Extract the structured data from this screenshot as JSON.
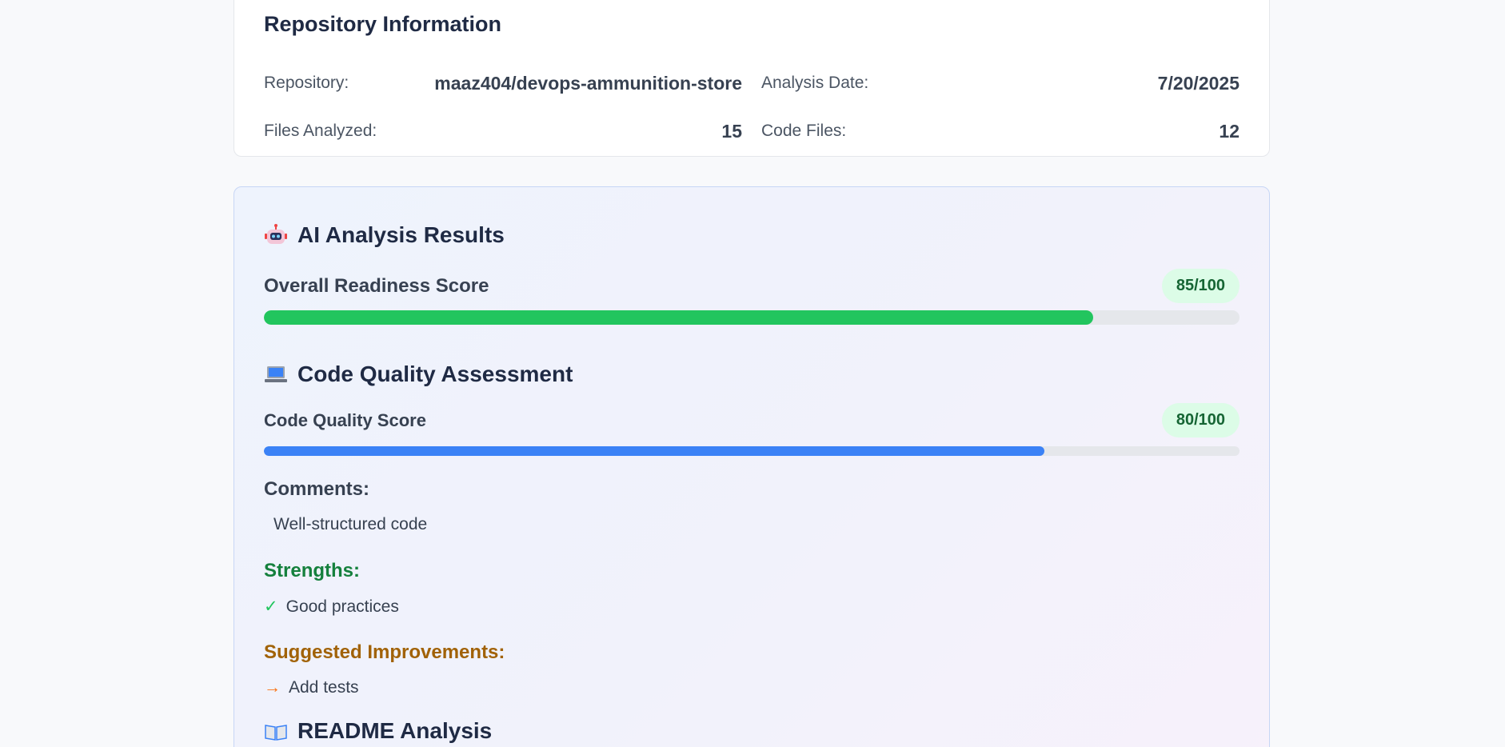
{
  "repo_info": {
    "title": "Repository Information",
    "rows": [
      {
        "label": "Repository:",
        "value": "maaz404/devops-ammunition-store"
      },
      {
        "label": "Analysis Date:",
        "value": "7/20/2025"
      },
      {
        "label": "Files Analyzed:",
        "value": "15"
      },
      {
        "label": "Code Files:",
        "value": "12"
      }
    ]
  },
  "ai_analysis": {
    "title": "AI Analysis Results",
    "icon": "robot-icon",
    "overall": {
      "label": "Overall Readiness Score",
      "badge": "85/100",
      "value": 85,
      "max": 100,
      "bar_color": "#22c55e"
    },
    "code_quality": {
      "title": "Code Quality Assessment",
      "icon": "laptop-icon",
      "score_label": "Code Quality Score",
      "badge": "80/100",
      "value": 80,
      "max": 100,
      "bar_color": "#3b82f6",
      "comments_label": "Comments:",
      "comments": "Well-structured code",
      "strengths_label": "Strengths:",
      "strengths_color": "#15803d",
      "strengths": [
        "Good practices"
      ],
      "strength_glyph": "✓",
      "improvements_label": "Suggested Improvements:",
      "improvements_color": "#a16207",
      "improvements": [
        "Add tests"
      ],
      "improvement_glyph": "→"
    },
    "readme": {
      "title": "README Analysis",
      "icon": "open-book-icon"
    }
  }
}
